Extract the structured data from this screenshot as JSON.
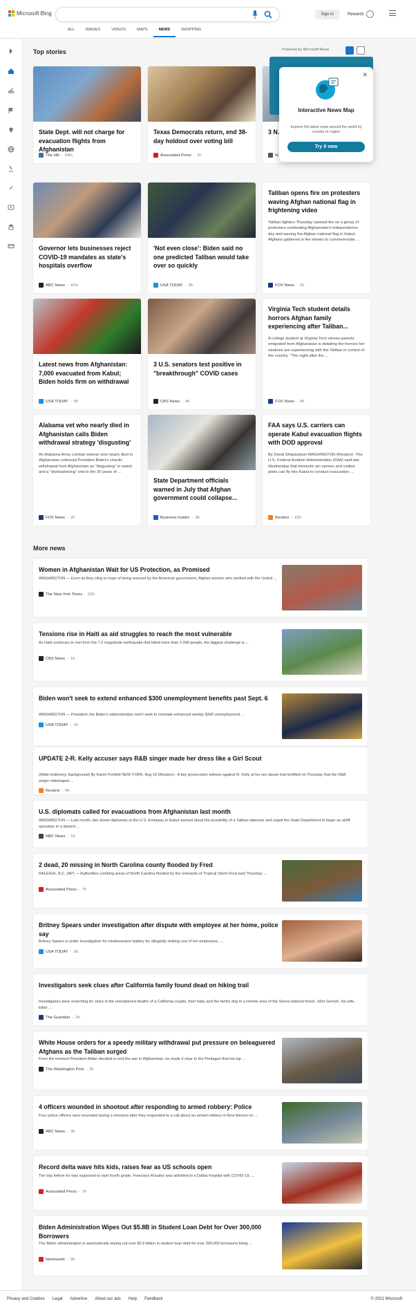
{
  "header": {
    "brand": "Microsoft Bing",
    "search_value": "",
    "signin": "Sign in",
    "rewards": "Rewards",
    "tabs": [
      "ALL",
      "IMAGES",
      "VIDEOS",
      "MAPS",
      "NEWS",
      "SHOPPING"
    ],
    "active_tab": "NEWS"
  },
  "top_stories": {
    "heading": "Top stories",
    "powered": "Powered by Microsoft News"
  },
  "popup": {
    "title": "Interactive News Map",
    "desc": "Explore the latest news around the world by country or region",
    "button": "Try it now"
  },
  "cards": [
    {
      "title": "State Dept. will not charge for evacuation flights from Afghanistan",
      "source": "The Hill",
      "time": "54m",
      "color": "#3c6fb4"
    },
    {
      "title": "Texas Democrats return, end 38-day holdout over voting bill",
      "source": "Associated Press",
      "time": "1h",
      "color": "#d02020"
    },
    {
      "title": "3 N.J. vacat near",
      "source": "NJ.com",
      "time": "2h",
      "color": "#555"
    },
    {
      "title": "Governor lets businesses reject COVID-19 mandates as state's hospitals overflow",
      "source": "ABC News",
      "time": "47m",
      "color": "#222"
    },
    {
      "title": "'Not even close': Biden said no one predicted Taliban would take over so quickly",
      "source": "USA TODAY",
      "time": "3h",
      "color": "#1a8fe0"
    },
    {
      "title": "Taliban opens fire on protesters waving Afghan national flag in frightening video",
      "snippet": "Taliban fighters Thursday opened fire on a group of protesters celebrating Afghanistan's independence day and waving the Afghan national flag in Kabul.  Afghans gathered in the streets to commemorate ...",
      "source": "FOX News",
      "time": "2h",
      "color": "#1b3a7a"
    },
    {
      "title": "Latest news from Afghanistan: 7,000 evacuated from Kabul; Biden holds firm on withdrawal",
      "source": "USA TODAY",
      "time": "5h",
      "color": "#1a8fe0"
    },
    {
      "title": "3 U.S. senators test positive in \"breakthrough\" COVID cases",
      "source": "CBS News",
      "time": "4h",
      "color": "#222"
    },
    {
      "title": "Virginia Tech student details horrors Afghan family experiencing after Taliban...",
      "snippet": "A college student at Virginia Tech whose parents emigrated from Afghanistan is detailing the horrors her relatives are experiencing with the Taliban in control of the country.  \"The night after the ...",
      "source": "FOX News",
      "time": "9h",
      "color": "#1b3a7a"
    },
    {
      "title": "Alabama vet who nearly died in Afghanistan calls Biden withdrawal strategy 'disgusting'",
      "snippet": "An Alabama Army combat veteran who nearly died in Afghanistan criticized President Biden's chaotic withdrawal from Afghanistan as \"disgusting\" to watch and a \"disheartening\" end to the 20 years of ...",
      "source": "FOX News",
      "time": "2h",
      "color": "#1b3a7a"
    },
    {
      "title": "State Department officials warned in July that Afghan government could collapse...",
      "source": "Business Insider",
      "time": "3h",
      "color": "#1f5cc8"
    },
    {
      "title": "FAA says U.S. carriers can operate Kabul evacuation flights with DOD approval",
      "snippet": "By David Shepardson WASHINGTON (Reuters) -The U.S. Federal Aviation Administration (FAA) said late Wednesday that domestic air carriers and civilian pilots can fly into Kabul to conduct evacuation ...",
      "source": "Reuters",
      "time": "22h",
      "color": "#f08020"
    }
  ],
  "more_news": {
    "heading": "More news",
    "items": [
      {
        "title": "Women in Afghanistan Wait for US Protection, as Promised",
        "snippet": "WASHINGTON — Even as they cling to hope of being rescued by the American government, Afghan women who worked with the United ...",
        "source": "The New York Times",
        "time": "22h",
        "color": "#222"
      },
      {
        "title": "Tensions rise in Haiti as aid struggles to reach the most vulnerable",
        "snippet": "As Haiti continues to reel from the 7.2 magnitude earthquake that killed more than 2,000 people, the biggest challenge is ...",
        "source": "CBS News",
        "time": "1h",
        "color": "#222"
      },
      {
        "title": "Biden won't seek to extend enhanced $300 unemployment benefits past Sept. 6",
        "snippet": "WASHINGTON — President Joe Biden's administration won't seek to reinstate enhanced weekly $300 unemployment ...",
        "source": "USA TODAY",
        "time": "1h",
        "color": "#1a8fe0"
      },
      {
        "title": "UPDATE 2-R. Kelly accuser says R&B singer made her dress like a Girl Scout",
        "snippet": "(Adds testimony, background) By Karen Freifeld NEW YORK, Aug 19 (Reuters) - A key prosecution witness against R. Kelly at his sex abuse trial testified on Thursday that the R&B singer videotaped ...",
        "source": "Reuters",
        "time": "6h",
        "color": "#f08020"
      },
      {
        "title": "U.S. diplomats called for evacuations from Afghanistan last month",
        "snippet": "WASHINGTON — Last month, two dozen diplomats at the U.S. Embassy in Kabul warned about the possibility of a Taliban takeover and urged the State Department to begin an airlift operation in a dissent ...",
        "source": "NBC News",
        "time": "1h",
        "color": "#444"
      },
      {
        "title": "2 dead, 20 missing in North Carolina county flooded by Fred",
        "snippet": "RALEIGH, N.C. (AP) — Authorities combing areas of North Carolina flooded by the remnants of Tropical Storm Fred said Thursday ...",
        "source": "Associated Press",
        "time": "7h",
        "color": "#d02020"
      },
      {
        "title": "Britney Spears under investigation after dispute with employee at her home, police say",
        "snippet": "Britney Spears is under investigation for misdemeanor battery for allegedly striking one of her employees, ...",
        "source": "USA TODAY",
        "time": "3h",
        "color": "#1a8fe0"
      },
      {
        "title": "Investigators seek clues after California family found dead on hiking trail",
        "snippet": "Investigators were searching for clues in the unexplained deaths of a California couple, their baby and the family dog in a remote area of the Sierra national forest. John Gerrish, his wife, Ellen ...",
        "source": "The Guardian",
        "time": "2h",
        "color": "#1c3d74"
      },
      {
        "title": "White House orders for a speedy military withdrawal put pressure on beleaguered Afghans as the Taliban surged",
        "snippet": "From the moment President Biden decided to end the war in Afghanistan, he made it clear to the Pentagon that his top ...",
        "source": "The Washington Post",
        "time": "2h",
        "color": "#222"
      },
      {
        "title": "4 officers wounded in shootout after responding to armed robbery: Police",
        "snippet": "Four police officers were wounded during a shootout after they responded to a call about an armed robbery in New Mexico on ...",
        "source": "ABC News",
        "time": "3h",
        "color": "#222"
      },
      {
        "title": "Record delta wave hits kids, raises fear as US schools open",
        "snippet": "The day before he was supposed to start fourth grade, Francisco Rosales was admitted to a Dallas hospital with COVID-19, ...",
        "source": "Associated Press",
        "time": "7h",
        "color": "#d02020"
      },
      {
        "title": "Biden Administration Wipes Out $5.8B in Student Loan Debt for Over 300,000 Borrowers",
        "snippet": "The Biden administration is automatically wiping out over $5.8 billion in student loan debt for over 300,000 borrowers living ...",
        "source": "Newsweek",
        "time": "9h",
        "color": "#e02020"
      }
    ]
  },
  "footer": {
    "links": [
      "Privacy and Cookies",
      "Legal",
      "Advertise",
      "About our ads",
      "Help",
      "Feedback"
    ],
    "copyright": "© 2021 Microsoft"
  }
}
